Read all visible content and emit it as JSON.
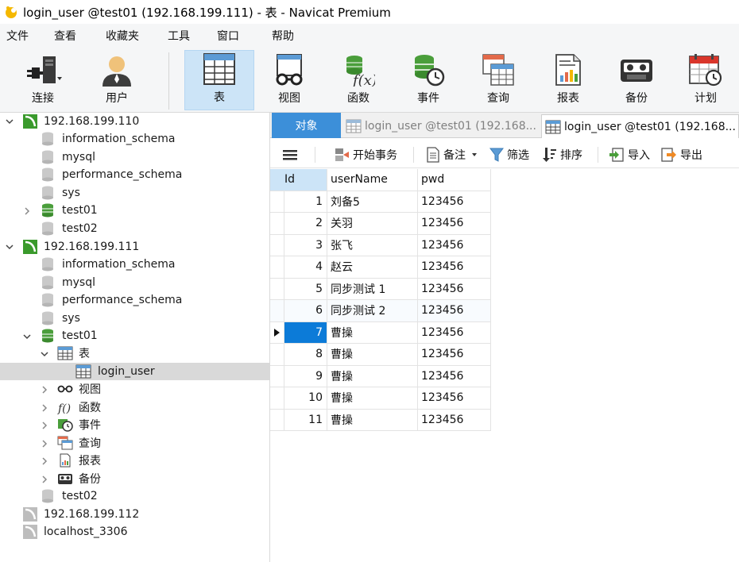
{
  "window": {
    "title": "login_user @test01 (192.168.199.111) - 表 - Navicat Premium"
  },
  "menu": [
    "文件",
    "查看",
    "收藏夹",
    "工具",
    "窗口",
    "帮助"
  ],
  "ribbon": {
    "connection": "连接",
    "user": "用户",
    "table": "表",
    "view": "视图",
    "function": "函数",
    "event": "事件",
    "query": "查询",
    "report": "报表",
    "backup": "备份",
    "schedule": "计划"
  },
  "tree": {
    "conn1": "192.168.199.110",
    "conn1_dbs": [
      "information_schema",
      "mysql",
      "performance_schema",
      "sys",
      "test01",
      "test02"
    ],
    "conn2": "192.168.199.111",
    "conn2_dbs": [
      "information_schema",
      "mysql",
      "performance_schema",
      "sys",
      "test01"
    ],
    "tables_label": "表",
    "table_item": "login_user",
    "views_label": "视图",
    "functions_label": "函数",
    "events_label": "事件",
    "queries_label": "查询",
    "reports_label": "报表",
    "backups_label": "备份",
    "conn2_last_db": "test02",
    "conn3": "192.168.199.112",
    "conn4": "localhost_3306"
  },
  "tabs": {
    "objects": "对象",
    "tab1": "login_user @test01 (192.168...",
    "tab2": "login_user @test01 (192.168..."
  },
  "toolbar": {
    "begin_transaction": "开始事务",
    "memo": "备注",
    "filter": "筛选",
    "sort": "排序",
    "import": "导入",
    "export": "导出"
  },
  "grid": {
    "columns": [
      "Id",
      "userName",
      "pwd"
    ],
    "rows": [
      [
        "1",
        "刘备5",
        "123456"
      ],
      [
        "2",
        "关羽",
        "123456"
      ],
      [
        "3",
        "张飞",
        "123456"
      ],
      [
        "4",
        "赵云",
        "123456"
      ],
      [
        "5",
        "同步测试 1",
        "123456"
      ],
      [
        "6",
        "同步测试 2",
        "123456"
      ],
      [
        "7",
        "曹操",
        "123456"
      ],
      [
        "8",
        "曹操",
        "123456"
      ],
      [
        "9",
        "曹操",
        "123456"
      ],
      [
        "10",
        "曹操",
        "123456"
      ],
      [
        "11",
        "曹操",
        "123456"
      ]
    ]
  }
}
